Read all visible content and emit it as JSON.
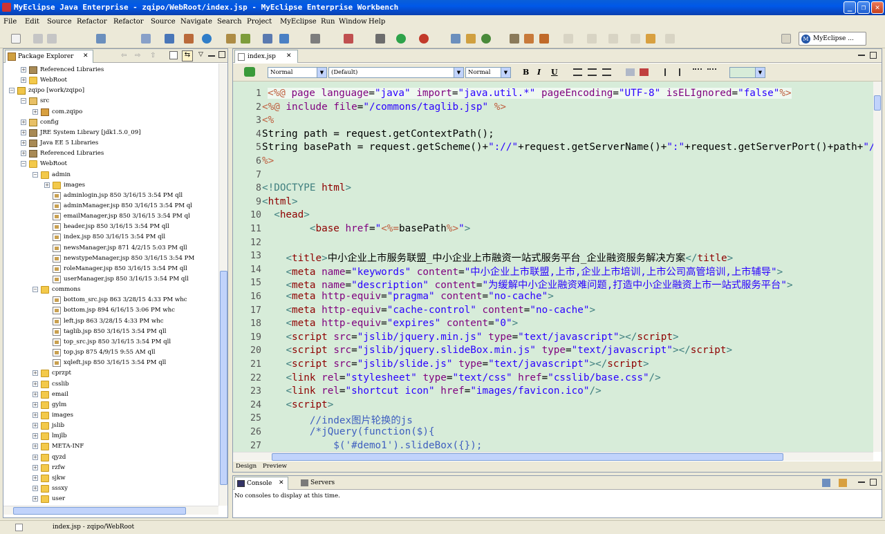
{
  "window": {
    "title": "MyEclipse Java Enterprise - zqipo/WebRoot/index.jsp - MyEclipse Enterprise Workbench"
  },
  "menu": [
    "File",
    "Edit",
    "Source",
    "Refactor",
    "Refactor",
    "Source",
    "Navigate",
    "Search",
    "Project",
    "MyEclipse",
    "Run",
    "Window",
    "Help"
  ],
  "perspective": {
    "label": "MyEclipse ..."
  },
  "package_explorer": {
    "tab_label": "Package Explorer",
    "rows": [
      {
        "indent": 1,
        "expander": "+",
        "icon": "lib",
        "label": "Referenced Libraries"
      },
      {
        "indent": 1,
        "expander": "+",
        "icon": "folder",
        "label": "WebRoot"
      },
      {
        "indent": 0,
        "expander": "-",
        "icon": "proj",
        "label": "zqipo [work/zqipo]"
      },
      {
        "indent": 1,
        "expander": "-",
        "icon": "srcf",
        "label": "src"
      },
      {
        "indent": 2,
        "expander": "+",
        "icon": "pkg",
        "label": "com.zqipo"
      },
      {
        "indent": 1,
        "expander": "+",
        "icon": "srcf",
        "label": "config"
      },
      {
        "indent": 1,
        "expander": "+",
        "icon": "lib",
        "label": "JRE System Library [jdk1.5.0_09]"
      },
      {
        "indent": 1,
        "expander": "+",
        "icon": "lib",
        "label": "Java EE 5 Libraries"
      },
      {
        "indent": 1,
        "expander": "+",
        "icon": "lib",
        "label": "Referenced Libraries"
      },
      {
        "indent": 1,
        "expander": "-",
        "icon": "folder",
        "label": "WebRoot"
      },
      {
        "indent": 2,
        "expander": "-",
        "icon": "folder",
        "label": "admin"
      },
      {
        "indent": 3,
        "expander": "+",
        "icon": "folder",
        "label": "images"
      },
      {
        "indent": 3,
        "expander": "",
        "icon": "jsp",
        "label": "adminlogin.jsp 850  3/16/15 3:54 PM  qll"
      },
      {
        "indent": 3,
        "expander": "",
        "icon": "jsp",
        "label": "adminManager.jsp 850  3/16/15 3:54 PM  ql"
      },
      {
        "indent": 3,
        "expander": "",
        "icon": "jsp",
        "label": "emailManager.jsp 850  3/16/15 3:54 PM  ql"
      },
      {
        "indent": 3,
        "expander": "",
        "icon": "jsp",
        "label": "header.jsp 850  3/16/15 3:54 PM  qll"
      },
      {
        "indent": 3,
        "expander": "",
        "icon": "jsp",
        "label": "index.jsp 850  3/16/15 3:54 PM  qll"
      },
      {
        "indent": 3,
        "expander": "",
        "icon": "jsp",
        "label": "newsManager.jsp 871  4/2/15 5:03 PM  qll"
      },
      {
        "indent": 3,
        "expander": "",
        "icon": "jsp",
        "label": "newstypeManager.jsp 850  3/16/15 3:54 PM"
      },
      {
        "indent": 3,
        "expander": "",
        "icon": "jsp",
        "label": "roleManager.jsp 850  3/16/15 3:54 PM  qll"
      },
      {
        "indent": 3,
        "expander": "",
        "icon": "jsp",
        "label": "userManager.jsp 850  3/16/15 3:54 PM  qll"
      },
      {
        "indent": 2,
        "expander": "-",
        "icon": "folder",
        "label": "commons"
      },
      {
        "indent": 3,
        "expander": "",
        "icon": "jsp",
        "label": "bottom_src.jsp 863  3/28/15 4:33 PM  whc"
      },
      {
        "indent": 3,
        "expander": "",
        "icon": "jsp",
        "label": "bottom.jsp 894  6/16/15 3:06 PM  whc"
      },
      {
        "indent": 3,
        "expander": "",
        "icon": "jsp",
        "label": "left.jsp 863  3/28/15 4:33 PM  whc"
      },
      {
        "indent": 3,
        "expander": "",
        "icon": "jsp",
        "label": "taglib.jsp 850  3/16/15 3:54 PM  qll"
      },
      {
        "indent": 3,
        "expander": "",
        "icon": "jsp",
        "label": "top_src.jsp 850  3/16/15 3:54 PM  qll"
      },
      {
        "indent": 3,
        "expander": "",
        "icon": "jsp",
        "label": "top.jsp 875  4/9/15 9:55 AM  qll"
      },
      {
        "indent": 3,
        "expander": "",
        "icon": "jsp",
        "label": "xqleft.jsp 850  3/16/15 3:54 PM  qll"
      },
      {
        "indent": 2,
        "expander": "+",
        "icon": "folder",
        "label": "cprzpt"
      },
      {
        "indent": 2,
        "expander": "+",
        "icon": "folder",
        "label": "csslib"
      },
      {
        "indent": 2,
        "expander": "+",
        "icon": "folder",
        "label": "email"
      },
      {
        "indent": 2,
        "expander": "+",
        "icon": "folder",
        "label": "gylm"
      },
      {
        "indent": 2,
        "expander": "+",
        "icon": "folder",
        "label": "images"
      },
      {
        "indent": 2,
        "expander": "+",
        "icon": "folder",
        "label": "jslib"
      },
      {
        "indent": 2,
        "expander": "+",
        "icon": "folder",
        "label": "lmjlb"
      },
      {
        "indent": 2,
        "expander": "+",
        "icon": "folder",
        "label": "META-INF"
      },
      {
        "indent": 2,
        "expander": "+",
        "icon": "folder",
        "label": "qyzd"
      },
      {
        "indent": 2,
        "expander": "+",
        "icon": "folder",
        "label": "rzfw"
      },
      {
        "indent": 2,
        "expander": "+",
        "icon": "folder",
        "label": "sjkw"
      },
      {
        "indent": 2,
        "expander": "+",
        "icon": "folder",
        "label": "sssxy"
      },
      {
        "indent": 2,
        "expander": "+",
        "icon": "folder",
        "label": "user"
      }
    ]
  },
  "editor": {
    "tab_label": "index.jsp",
    "format": {
      "paragraph": "Normal",
      "font": "(Default)",
      "size": "Normal"
    },
    "bottom_tabs": [
      "Design",
      "Preview"
    ],
    "lines": [
      [
        [
          "dir",
          "<%@ "
        ],
        [
          "a",
          "page "
        ],
        [
          "a",
          "language"
        ],
        [
          "",
          "="
        ],
        [
          "s",
          "\"java\""
        ],
        [
          "",
          " "
        ],
        [
          "a",
          "import"
        ],
        [
          "",
          "="
        ],
        [
          "s",
          "\"java.util.*\""
        ],
        [
          "",
          " "
        ],
        [
          "a",
          "pageEncoding"
        ],
        [
          "",
          "="
        ],
        [
          "s",
          "\"UTF-8\""
        ],
        [
          "",
          " "
        ],
        [
          "a",
          "isELIgnored"
        ],
        [
          "",
          "="
        ],
        [
          "s",
          "\"false\""
        ],
        [
          "dir",
          "%>"
        ]
      ],
      [
        [
          "dir",
          "<%@ "
        ],
        [
          "a",
          "include "
        ],
        [
          "a",
          "file"
        ],
        [
          "",
          "="
        ],
        [
          "s",
          "\"/commons/taglib.jsp\""
        ],
        [
          "",
          " "
        ],
        [
          "dir",
          "%>"
        ]
      ],
      [
        [
          "dir",
          "<%"
        ]
      ],
      [
        [
          "",
          "String path = request.getContextPath();"
        ]
      ],
      [
        [
          "",
          "String basePath = request.getScheme()+"
        ],
        [
          "s",
          "\"://\""
        ],
        [
          "",
          "+request.getServerName()+"
        ],
        [
          "s",
          "\":\""
        ],
        [
          "",
          "+request.getServerPort()+path+"
        ],
        [
          "s",
          "\"/\""
        ],
        [
          "",
          ";"
        ]
      ],
      [
        [
          "dir",
          "%>"
        ]
      ],
      [
        [
          "",
          ""
        ]
      ],
      [
        [
          "k",
          "<!DOCTYPE "
        ],
        [
          "tg",
          "html"
        ],
        [
          "k",
          ">"
        ]
      ],
      [
        [
          "k",
          "<"
        ],
        [
          "tg",
          "html"
        ],
        [
          "k",
          ">"
        ]
      ],
      [
        [
          "",
          "  "
        ],
        [
          "k",
          "<"
        ],
        [
          "tg",
          "head"
        ],
        [
          "k",
          ">"
        ]
      ],
      [
        [
          "",
          "        "
        ],
        [
          "k",
          "<"
        ],
        [
          "tg",
          "base "
        ],
        [
          "a",
          "href"
        ],
        [
          "",
          "="
        ],
        [
          "s",
          "\""
        ],
        [
          "dir",
          "<%="
        ],
        [
          "",
          "basePath"
        ],
        [
          "dir",
          "%>"
        ],
        [
          "s",
          "\""
        ],
        [
          "k",
          ">"
        ]
      ],
      [
        [
          "",
          ""
        ]
      ],
      [
        [
          "",
          "    "
        ],
        [
          "k",
          "<"
        ],
        [
          "tg",
          "title"
        ],
        [
          "k",
          ">"
        ],
        [
          "",
          "中小企业上市服务联盟_中小企业上市融资一站式服务平台_企业融资服务解决方案"
        ],
        [
          "k",
          "</"
        ],
        [
          "tg",
          "title"
        ],
        [
          "k",
          ">"
        ]
      ],
      [
        [
          "",
          "    "
        ],
        [
          "k",
          "<"
        ],
        [
          "tg",
          "meta "
        ],
        [
          "a",
          "name"
        ],
        [
          "",
          "="
        ],
        [
          "s",
          "\"keywords\""
        ],
        [
          "",
          " "
        ],
        [
          "a",
          "content"
        ],
        [
          "",
          "="
        ],
        [
          "s",
          "\"中小企业上市联盟,上市,企业上市培训,上市公司高管培训,上市辅导\""
        ],
        [
          "k",
          ">"
        ]
      ],
      [
        [
          "",
          "    "
        ],
        [
          "k",
          "<"
        ],
        [
          "tg",
          "meta "
        ],
        [
          "a",
          "name"
        ],
        [
          "",
          "="
        ],
        [
          "s",
          "\"description\""
        ],
        [
          "",
          " "
        ],
        [
          "a",
          "content"
        ],
        [
          "",
          "="
        ],
        [
          "s",
          "\"为缓解中小企业融资难问题,打造中小企业融资上市一站式服务平台\""
        ],
        [
          "k",
          ">"
        ]
      ],
      [
        [
          "",
          "    "
        ],
        [
          "k",
          "<"
        ],
        [
          "tg",
          "meta "
        ],
        [
          "a",
          "http-equiv"
        ],
        [
          "",
          "="
        ],
        [
          "s",
          "\"pragma\""
        ],
        [
          "",
          " "
        ],
        [
          "a",
          "content"
        ],
        [
          "",
          "="
        ],
        [
          "s",
          "\"no-cache\""
        ],
        [
          "k",
          ">"
        ]
      ],
      [
        [
          "",
          "    "
        ],
        [
          "k",
          "<"
        ],
        [
          "tg",
          "meta "
        ],
        [
          "a",
          "http-equiv"
        ],
        [
          "",
          "="
        ],
        [
          "s",
          "\"cache-control\""
        ],
        [
          "",
          " "
        ],
        [
          "a",
          "content"
        ],
        [
          "",
          "="
        ],
        [
          "s",
          "\"no-cache\""
        ],
        [
          "k",
          ">"
        ]
      ],
      [
        [
          "",
          "    "
        ],
        [
          "k",
          "<"
        ],
        [
          "tg",
          "meta "
        ],
        [
          "a",
          "http-equiv"
        ],
        [
          "",
          "="
        ],
        [
          "s",
          "\"expires\""
        ],
        [
          "",
          " "
        ],
        [
          "a",
          "content"
        ],
        [
          "",
          "="
        ],
        [
          "s",
          "\"0\""
        ],
        [
          "k",
          ">"
        ]
      ],
      [
        [
          "",
          "    "
        ],
        [
          "k",
          "<"
        ],
        [
          "tg",
          "script "
        ],
        [
          "a",
          "src"
        ],
        [
          "",
          "="
        ],
        [
          "s",
          "\"jslib/jquery.min.js\""
        ],
        [
          "",
          " "
        ],
        [
          "a",
          "type"
        ],
        [
          "",
          "="
        ],
        [
          "s",
          "\"text/javascript\""
        ],
        [
          "k",
          "></"
        ],
        [
          "tg",
          "script"
        ],
        [
          "k",
          ">"
        ]
      ],
      [
        [
          "",
          "    "
        ],
        [
          "k",
          "<"
        ],
        [
          "tg",
          "script "
        ],
        [
          "a",
          "src"
        ],
        [
          "",
          "="
        ],
        [
          "s",
          "\"jslib/jquery.slideBox.min.js\""
        ],
        [
          "",
          " "
        ],
        [
          "a",
          "type"
        ],
        [
          "",
          "="
        ],
        [
          "s",
          "\"text/javascript\""
        ],
        [
          "k",
          "></"
        ],
        [
          "tg",
          "script"
        ],
        [
          "k",
          ">"
        ]
      ],
      [
        [
          "",
          "    "
        ],
        [
          "k",
          "<"
        ],
        [
          "tg",
          "script "
        ],
        [
          "a",
          "src"
        ],
        [
          "",
          "="
        ],
        [
          "s",
          "\"jslib/slide.js\""
        ],
        [
          "",
          " "
        ],
        [
          "a",
          "type"
        ],
        [
          "",
          "="
        ],
        [
          "s",
          "\"text/javascript\""
        ],
        [
          "k",
          "></"
        ],
        [
          "tg",
          "script"
        ],
        [
          "k",
          ">"
        ]
      ],
      [
        [
          "",
          "    "
        ],
        [
          "k",
          "<"
        ],
        [
          "tg",
          "link "
        ],
        [
          "a",
          "rel"
        ],
        [
          "",
          "="
        ],
        [
          "s",
          "\"stylesheet\""
        ],
        [
          "",
          " "
        ],
        [
          "a",
          "type"
        ],
        [
          "",
          "="
        ],
        [
          "s",
          "\"text/css\""
        ],
        [
          "",
          " "
        ],
        [
          "a",
          "href"
        ],
        [
          "",
          "="
        ],
        [
          "s",
          "\"csslib/base.css\""
        ],
        [
          "k",
          "/>"
        ]
      ],
      [
        [
          "",
          "    "
        ],
        [
          "k",
          "<"
        ],
        [
          "tg",
          "link "
        ],
        [
          "a",
          "rel"
        ],
        [
          "",
          "="
        ],
        [
          "s",
          "\"shortcut icon\""
        ],
        [
          "",
          " "
        ],
        [
          "a",
          "href"
        ],
        [
          "",
          "="
        ],
        [
          "s",
          "\"images/favicon.ico\""
        ],
        [
          "k",
          "/>"
        ]
      ],
      [
        [
          "",
          "    "
        ],
        [
          "k",
          "<"
        ],
        [
          "tg",
          "script"
        ],
        [
          "k",
          ">"
        ]
      ],
      [
        [
          "",
          "        "
        ],
        [
          "cm",
          "//index图片轮换的js"
        ]
      ],
      [
        [
          "",
          "        "
        ],
        [
          "cm",
          "/*jQuery(function($){"
        ]
      ],
      [
        [
          "",
          "            "
        ],
        [
          "cm",
          "$('#demo1').slideBox({});"
        ]
      ]
    ]
  },
  "console": {
    "tab_label": "Console",
    "servers_label": "Servers",
    "message": "No consoles to display at this time."
  },
  "status": {
    "text": "index.jsp - zqipo/WebRoot"
  }
}
